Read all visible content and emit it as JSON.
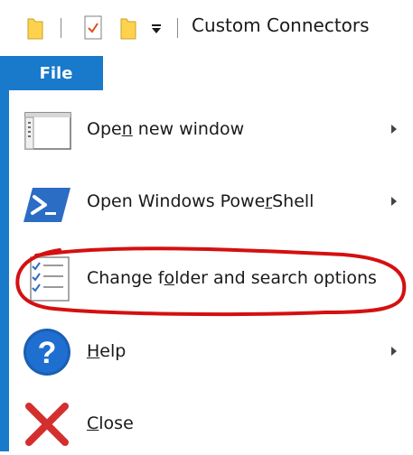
{
  "window": {
    "title": "Custom Connectors"
  },
  "file_tab": {
    "label": "File"
  },
  "menu": {
    "items": [
      {
        "label": "Open new window",
        "access_key": "n",
        "icon": "new-window-icon",
        "has_submenu": true
      },
      {
        "label": "Open Windows PowerShell",
        "access_key": "r",
        "icon": "powershell-icon",
        "has_submenu": true
      },
      {
        "label": "Change folder and search options",
        "access_key": "o",
        "icon": "folder-options-icon",
        "has_submenu": false
      },
      {
        "label": "Help",
        "access_key": "H",
        "icon": "help-icon",
        "has_submenu": true
      },
      {
        "label": "Close",
        "access_key": "C",
        "icon": "close-icon",
        "has_submenu": false
      }
    ]
  },
  "colors": {
    "accent": "#1979ca",
    "annotation_ink": "#d41010",
    "close_red": "#d32f2f"
  }
}
